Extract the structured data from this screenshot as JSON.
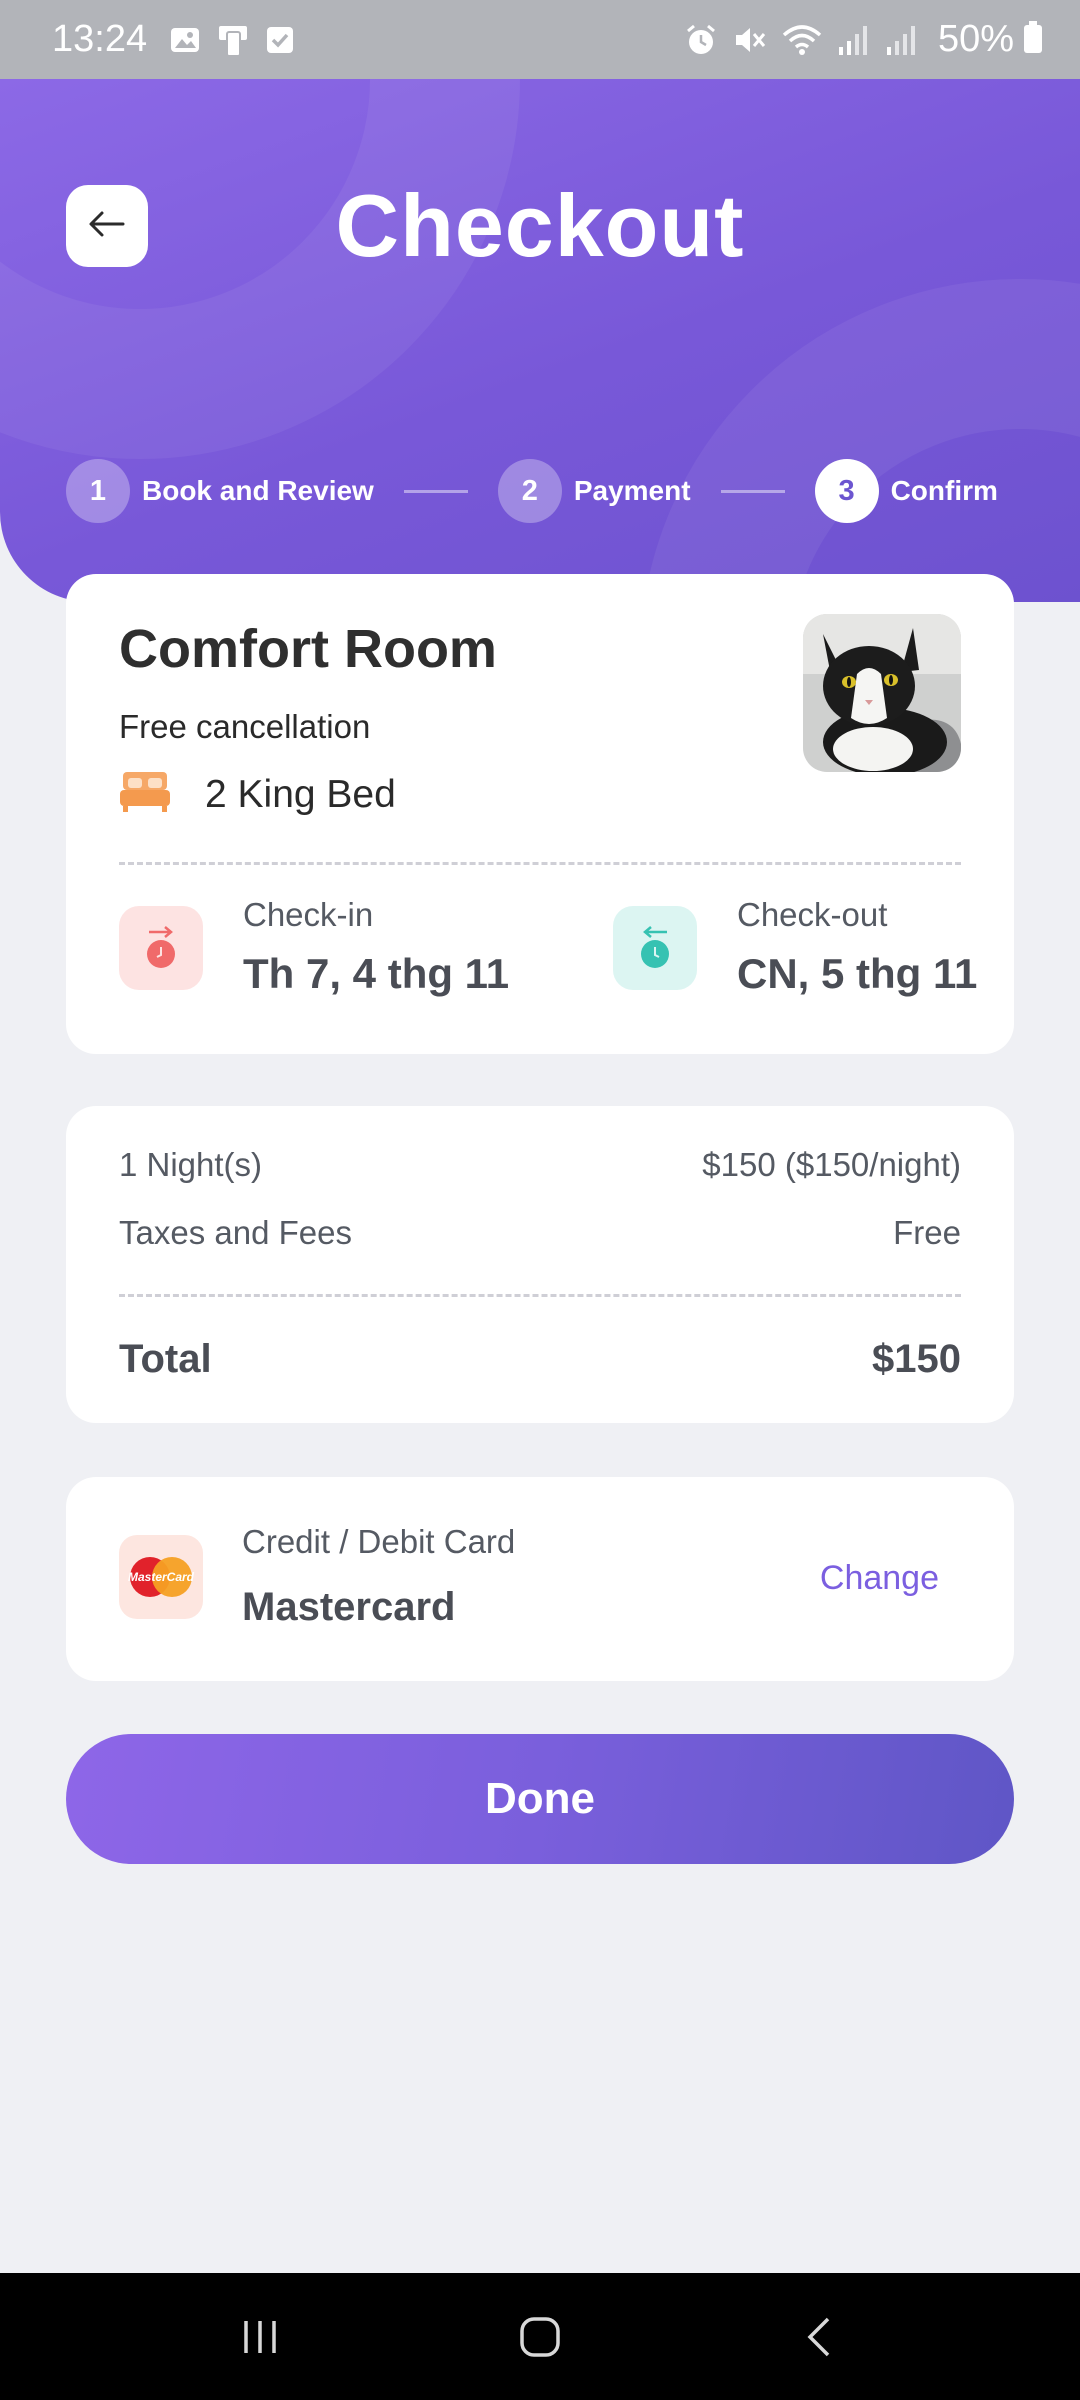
{
  "status_bar": {
    "time": "13:24",
    "battery": "50%",
    "left_icons": [
      "image-icon",
      "phone-sync-icon",
      "checkbox-icon"
    ],
    "right_icons": [
      "alarm-icon",
      "mute-icon",
      "wifi-icon",
      "signal-icon",
      "signal-icon",
      "battery-icon"
    ]
  },
  "header": {
    "title": "Checkout",
    "back_icon": "arrow-left-icon",
    "steps": [
      {
        "number": "1",
        "label": "Book and Review",
        "active": false
      },
      {
        "number": "2",
        "label": "Payment",
        "active": false
      },
      {
        "number": "3",
        "label": "Confirm",
        "active": true
      }
    ]
  },
  "room": {
    "name": "Comfort Room",
    "cancellation": "Free cancellation",
    "bed": "2 King Bed",
    "bed_icon": "bed-icon",
    "photo": "cat-photo"
  },
  "dates": {
    "checkin_label": "Check-in",
    "checkin_value": "Th 7, 4 thg 11",
    "checkout_label": "Check-out",
    "checkout_value": "CN, 5 thg 11"
  },
  "price": {
    "nights_label": "1 Night(s)",
    "nights_value": "$150 ($150/night)",
    "taxes_label": "Taxes and Fees",
    "taxes_value": "Free",
    "total_label": "Total",
    "total_value": "$150"
  },
  "payment": {
    "type": "Credit / Debit Card",
    "name": "Mastercard",
    "logo_text": "MasterCard",
    "change_label": "Change"
  },
  "done_label": "Done",
  "colors": {
    "accent": "#7b5fe0",
    "header_gradient_start": "#8c69e6",
    "header_gradient_end": "#6d52cf",
    "checkin_icon_bg": "#fde3e2",
    "checkout_icon_bg": "#dcf5f2",
    "background": "#eff0f4"
  }
}
